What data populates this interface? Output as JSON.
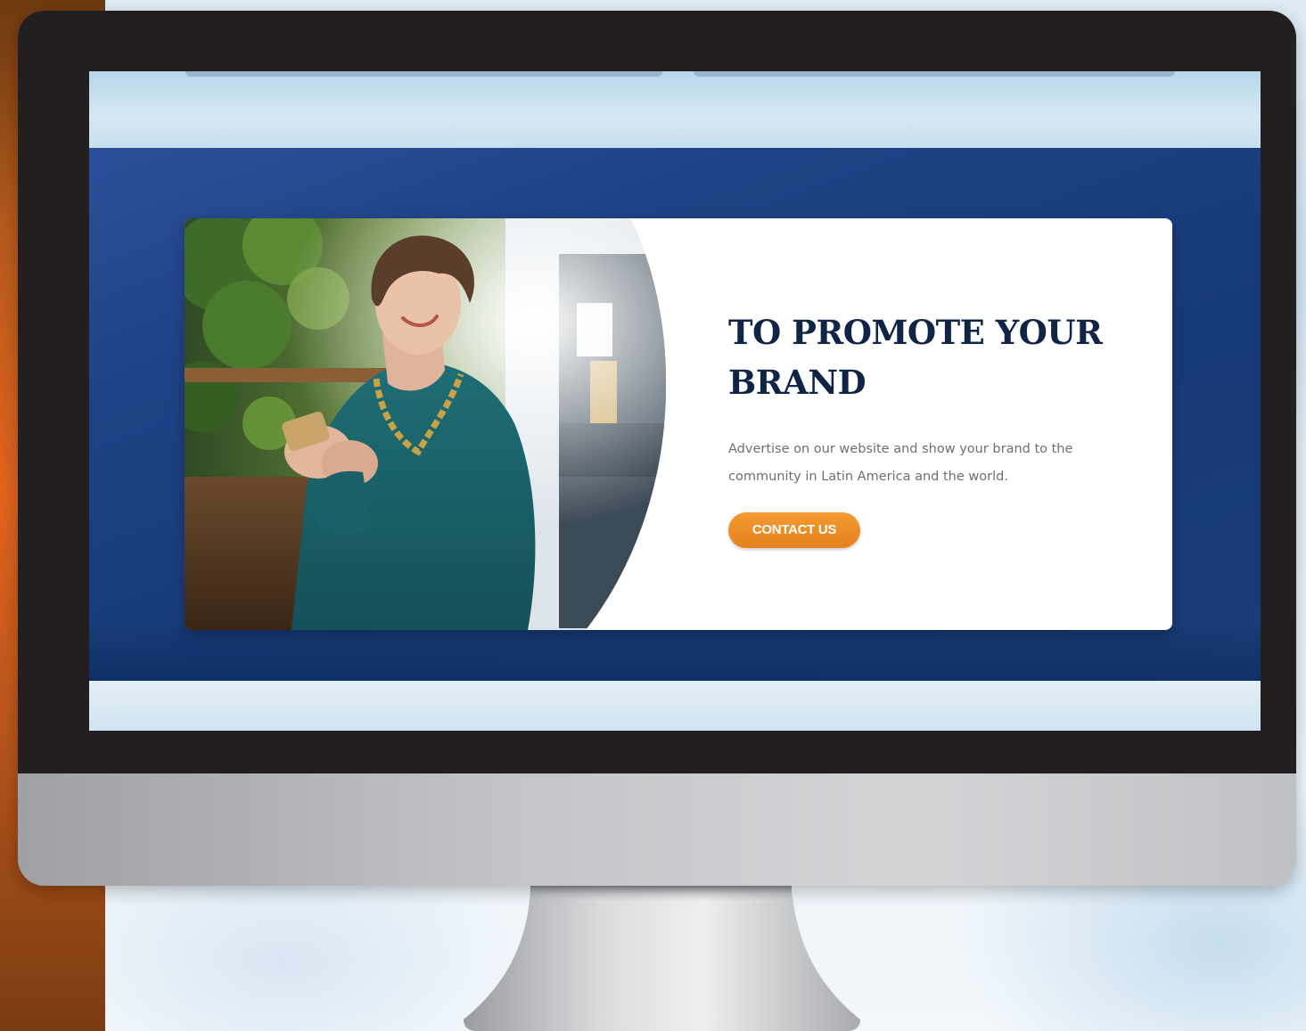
{
  "hero": {
    "headline": "TO PROMOTE YOUR BRAND",
    "body": "Advertise on our website and show your brand to the community in Latin America and the world.",
    "cta_label": "CONTACT US"
  },
  "colors": {
    "navy": "#1b3f7c",
    "headline": "#102446",
    "cta": "#ef8f24",
    "bezel": "#231e1f"
  },
  "icons": {
    "photo": "woman-with-phone-photo"
  }
}
